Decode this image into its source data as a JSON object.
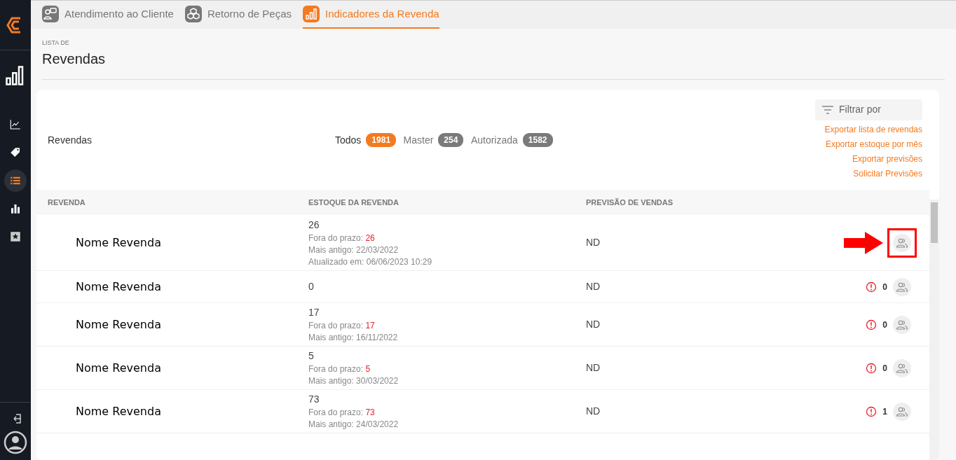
{
  "sidebar": {
    "items": [
      {
        "kind": "bars",
        "selected": false
      },
      {
        "kind": "chart",
        "selected": false
      },
      {
        "kind": "tag",
        "selected": false
      },
      {
        "kind": "list",
        "selected": true
      },
      {
        "kind": "columns",
        "selected": false
      },
      {
        "kind": "star",
        "selected": false
      }
    ]
  },
  "top_tabs": [
    {
      "label": "Atendimento ao Cliente",
      "kind": "support",
      "selected": false
    },
    {
      "label": "Retorno de Peças",
      "kind": "boxes",
      "selected": false
    },
    {
      "label": "Indicadores da Revenda",
      "kind": "bars",
      "selected": true
    }
  ],
  "page": {
    "overline": "LISTA DE",
    "title": "Revendas"
  },
  "panel": {
    "title": "Revendas",
    "filters": [
      {
        "label": "Todos",
        "count": "1981",
        "selected": true
      },
      {
        "label": "Master",
        "count": "254",
        "selected": false
      },
      {
        "label": "Autorizada",
        "count": "1582",
        "selected": false
      }
    ],
    "filter_button": "Filtrar por",
    "links": [
      "Exportar lista de revendas",
      "Exportar estoque por mês",
      "Exportar previsões",
      "Solicitar Previsões"
    ]
  },
  "table": {
    "columns": [
      "REVENDA",
      "ESTOQUE DA REVENDA",
      "PREVISÃO DE VENDAS"
    ],
    "rows": [
      {
        "name": "Nome Revenda",
        "stock": "26",
        "details": [
          {
            "label": "Fora do prazo:",
            "value": "26"
          },
          {
            "label": "Mais antigo: 22/03/2022"
          },
          {
            "label": "Atualizado em: 06/06/2023 10:29"
          }
        ],
        "forecast": "ND",
        "highlighted": true
      },
      {
        "name": "Nome Revenda",
        "stock": "0",
        "details": [],
        "forecast": "ND",
        "alert_count": "0",
        "highlighted": false
      },
      {
        "name": "Nome Revenda",
        "stock": "17",
        "details": [
          {
            "label": "Fora do prazo:",
            "value": "17"
          },
          {
            "label": "Mais antigo: 16/11/2022"
          }
        ],
        "forecast": "ND",
        "alert_count": "0",
        "highlighted": false
      },
      {
        "name": "Nome Revenda",
        "stock": "5",
        "details": [
          {
            "label": "Fora do prazo:",
            "value": "5"
          },
          {
            "label": "Mais antigo: 30/03/2022"
          }
        ],
        "forecast": "ND",
        "alert_count": "0",
        "highlighted": false
      },
      {
        "name": "Nome Revenda",
        "stock": "73",
        "details": [
          {
            "label": "Fora do prazo:",
            "value": "73"
          },
          {
            "label": "Mais antigo: 24/03/2022"
          }
        ],
        "forecast": "ND",
        "alert_count": "1",
        "highlighted": false
      }
    ]
  }
}
